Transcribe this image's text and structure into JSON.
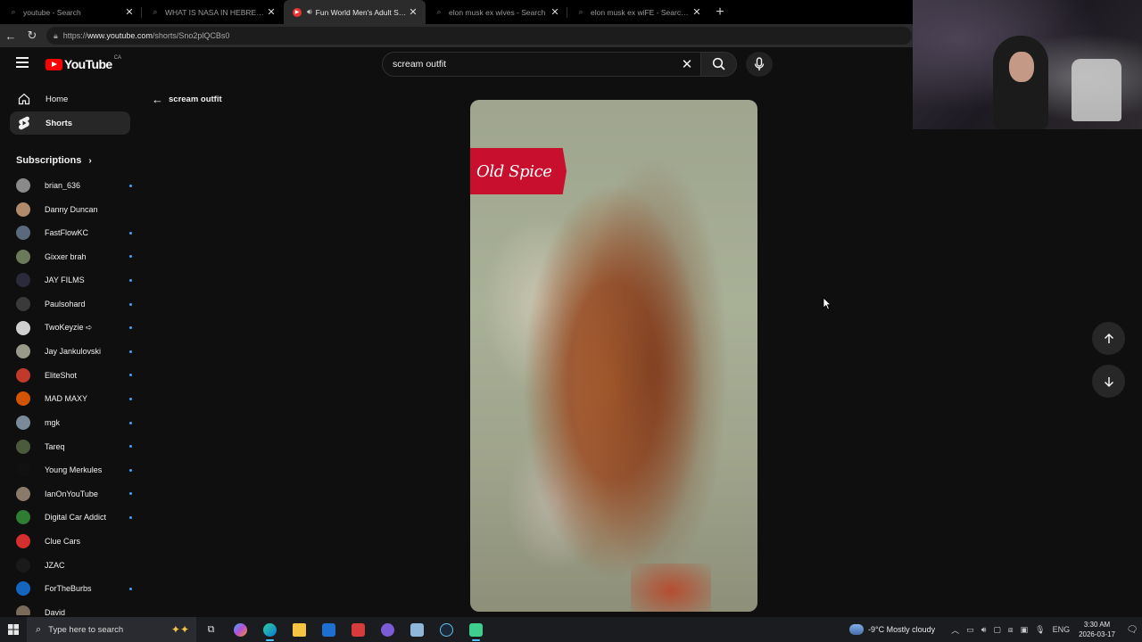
{
  "browser": {
    "tabs": [
      {
        "title": "youtube - Search",
        "active": false
      },
      {
        "title": "WHAT IS NASA IN HEBREW - Search",
        "active": false
      },
      {
        "title": "Fun World Men's Adult Scream",
        "active": true
      },
      {
        "title": "elon musk ex wives - Search",
        "active": false
      },
      {
        "title": "elon musk ex wiFE - Search Images",
        "active": false
      }
    ],
    "url_prefix": "https://",
    "url_domain": "www.youtube.com",
    "url_path": "/shorts/Sno2plQCBs0"
  },
  "header": {
    "logo_text": "YouTube",
    "country_code": "CA",
    "search_value": "scream outfit",
    "search_placeholder": "Search"
  },
  "sidebar": {
    "home_label": "Home",
    "shorts_label": "Shorts",
    "subscriptions_title": "Subscriptions",
    "subscriptions": [
      {
        "name": "brian_636",
        "new": true,
        "color": "#8a8a8a"
      },
      {
        "name": "Danny Duncan",
        "new": false,
        "color": "#b08a6a"
      },
      {
        "name": "FastFlowKC",
        "new": true,
        "color": "#5a6a7a"
      },
      {
        "name": "Gixxer brah",
        "new": true,
        "color": "#6a7a5a"
      },
      {
        "name": "JAY FILMS",
        "new": true,
        "color": "#2a2a3a"
      },
      {
        "name": "Paulsohard",
        "new": true,
        "color": "#3a3a3a"
      },
      {
        "name": "TwoKeyzie ➪",
        "new": true,
        "color": "#cfcfcf"
      },
      {
        "name": "Jay Jankulovski",
        "new": true,
        "color": "#9a9a8a"
      },
      {
        "name": "EliteShot",
        "new": true,
        "color": "#c0392b"
      },
      {
        "name": "MAD MAXY",
        "new": true,
        "color": "#d35400"
      },
      {
        "name": "mgk",
        "new": true,
        "color": "#7a8a9a"
      },
      {
        "name": "Tareq",
        "new": true,
        "color": "#4a5a3a"
      },
      {
        "name": "Young Merkules",
        "new": true,
        "color": "#111111"
      },
      {
        "name": "IanOnYouTube",
        "new": true,
        "color": "#8a7a6a"
      },
      {
        "name": "Digital Car Addict",
        "new": true,
        "color": "#2e7d32"
      },
      {
        "name": "Clue Cars",
        "new": false,
        "color": "#d32f2f"
      },
      {
        "name": "JZAC",
        "new": false,
        "color": "#1a1a1a"
      },
      {
        "name": "ForTheBurbs",
        "new": true,
        "color": "#1565c0"
      },
      {
        "name": "David",
        "new": false,
        "color": "#7a6a5a"
      }
    ]
  },
  "main": {
    "back_label": "scream outfit",
    "video_brand_text": "Old Spice"
  },
  "taskbar": {
    "search_placeholder": "Type here to search",
    "weather": "-9°C  Mostly cloudy",
    "language": "ENG",
    "time": "3:30 AM",
    "date": "2026-03-17"
  }
}
